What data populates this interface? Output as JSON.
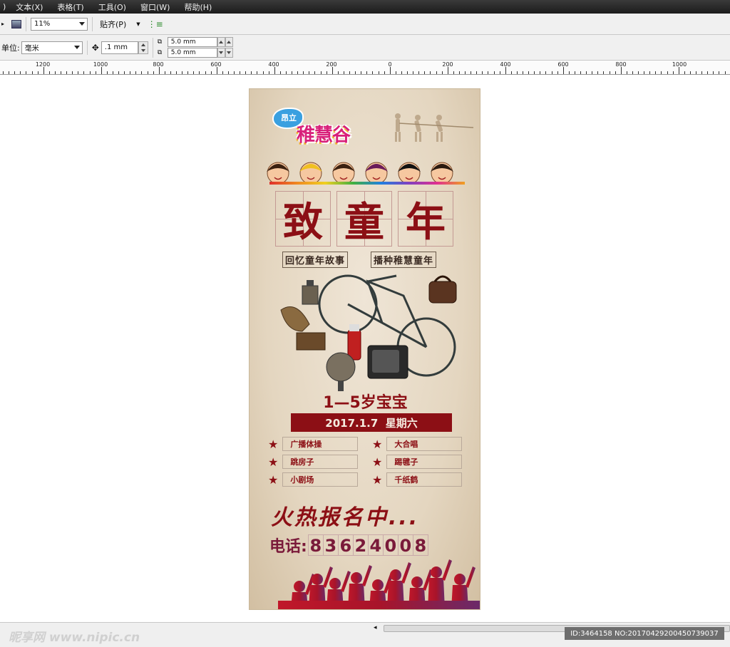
{
  "menu": [
    "文本(X)",
    "表格(T)",
    "工具(O)",
    "窗口(W)",
    "帮助(H)"
  ],
  "toolbar": {
    "zoom_value": "11%",
    "snap_label": "贴齐(P)",
    "units_label": "单位:",
    "units_value": "毫米",
    "nudge_value": ".1 mm",
    "dup_x": "5.0 mm",
    "dup_y": "5.0 mm"
  },
  "ruler_labels": [
    "1200",
    "1000",
    "800",
    "600",
    "400",
    "200",
    "0",
    "200",
    "400",
    "600",
    "800",
    "1000"
  ],
  "poster": {
    "logo_top": "昂立",
    "logo_main": "稚慧谷",
    "title_chars": [
      "致",
      "童",
      "年"
    ],
    "subtitle_left": "回忆童年故事",
    "subtitle_right": "播种稚慧童年",
    "age": "1—5岁宝宝",
    "date": "2017.1.7  星期六",
    "activities": [
      "广播体操",
      "大合唱",
      "跳房子",
      "踢毽子",
      "小剧场",
      "千纸鹤"
    ],
    "star": "★",
    "signup": "火热报名中...",
    "phone_label": "电话:",
    "phone_digits": [
      "8",
      "3",
      "6",
      "2",
      "4",
      "0",
      "0",
      "8"
    ]
  },
  "footer": {
    "watermark": "昵享网 www.nipic.cn",
    "image_id": "ID:3464158 NO:20170429200450739037"
  },
  "colors": {
    "poster_red": "#8c0f15",
    "paper": "#e8dcc8",
    "menubar": "#2a2a2a"
  }
}
